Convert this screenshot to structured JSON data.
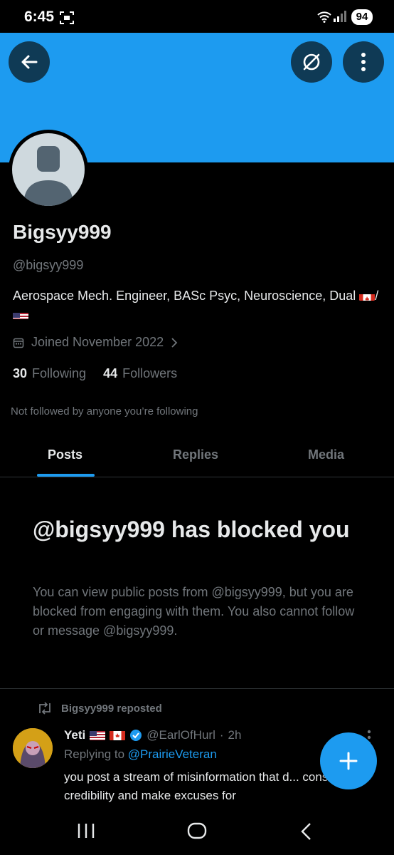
{
  "status_bar": {
    "time": "6:45",
    "battery": "94"
  },
  "profile": {
    "display_name": "Bigsyy999",
    "handle": "@bigsyy999",
    "bio_text": "Aerospace Mech. Engineer, BASc Psyc, Neuroscience, Dual",
    "bio_sep": "/",
    "joined": "Joined November 2022",
    "following_count": "30",
    "following_label": "Following",
    "followers_count": "44",
    "followers_label": "Followers",
    "not_followed": "Not followed by anyone you’re following"
  },
  "tabs": [
    {
      "label": "Posts",
      "active": true
    },
    {
      "label": "Replies",
      "active": false
    },
    {
      "label": "Media",
      "active": false
    }
  ],
  "blocked": {
    "title": "@bigsyy999 has blocked you",
    "description": "You can view public posts from @bigsyy999, but you are blocked from engaging with them. You also cannot follow or message @bigsyy999."
  },
  "post": {
    "repost_label": "Bigsyy999 reposted",
    "author_name": "Yeti",
    "author_handle": "@EarlOfHurl",
    "separator": "·",
    "time": "2h",
    "replying_prefix": "Replying to",
    "replying_to": "@PrairieVeteran",
    "text": "you post a stream of misinformation that d... conservative credibility and make excuses for"
  },
  "colors": {
    "accent": "#1d9bf0",
    "background": "#000000",
    "muted": "#71767b",
    "text": "#e7e9ea"
  },
  "icons": [
    "back-arrow-icon",
    "grok-icon",
    "more-vertical-icon",
    "calendar-icon",
    "chevron-right-icon",
    "repost-icon",
    "verified-badge-icon",
    "plus-icon",
    "recents-icon",
    "home-icon",
    "nav-back-icon"
  ]
}
